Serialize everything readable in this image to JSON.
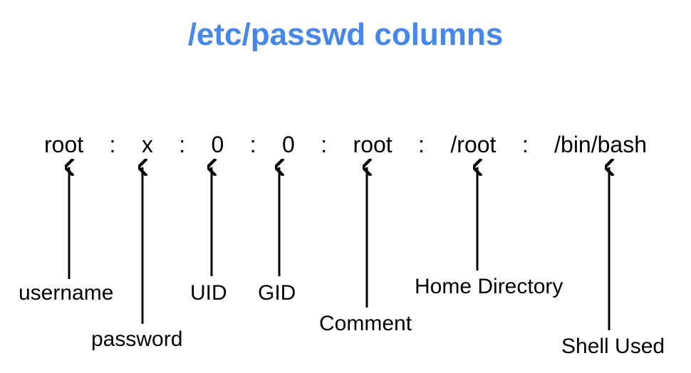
{
  "title": "/etc/passwd columns",
  "fields": {
    "f0": "root",
    "f1": "x",
    "f2": "0",
    "f3": "0",
    "f4": "root",
    "f5": "/root",
    "f6": "/bin/bash"
  },
  "separator": ":",
  "labels": {
    "username": "username",
    "password": "password",
    "uid": "UID",
    "gid": "GID",
    "comment": "Comment",
    "homedir": "Home Directory",
    "shell": "Shell Used"
  }
}
